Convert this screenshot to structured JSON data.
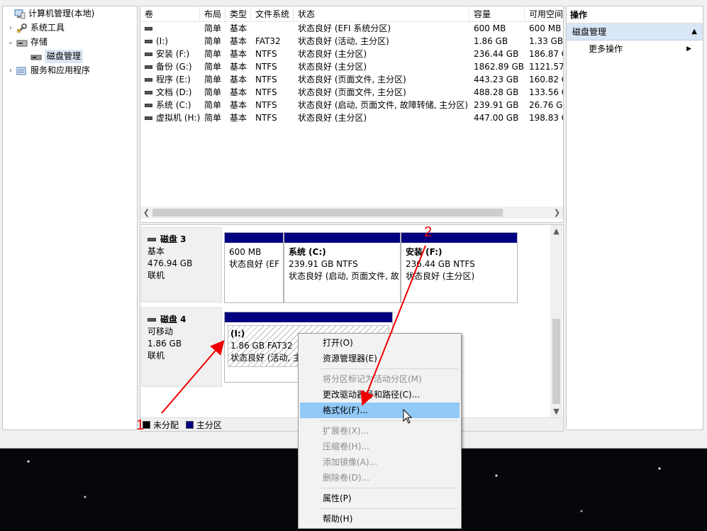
{
  "tree": {
    "items": [
      {
        "label": "计算机管理(本地)",
        "twisty": "",
        "icon": "computer-management-icon"
      },
      {
        "label": "系统工具",
        "twisty": "›",
        "icon": "system-tools-icon"
      },
      {
        "label": "存储",
        "twisty": "⌄",
        "icon": "storage-icon"
      },
      {
        "label": "磁盘管理",
        "twisty": "",
        "icon": "disk-management-icon"
      },
      {
        "label": "服务和应用程序",
        "twisty": "›",
        "icon": "services-apps-icon"
      }
    ]
  },
  "volume_list": {
    "columns": [
      "卷",
      "布局",
      "类型",
      "文件系统",
      "状态",
      "容量",
      "可用空间"
    ],
    "rows": [
      [
        "",
        "简单",
        "基本",
        "",
        "状态良好 (EFI 系统分区)",
        "600 MB",
        "600 MB"
      ],
      [
        "(I:)",
        "简单",
        "基本",
        "FAT32",
        "状态良好 (活动, 主分区)",
        "1.86 GB",
        "1.33 GB"
      ],
      [
        "安装 (F:)",
        "简单",
        "基本",
        "NTFS",
        "状态良好 (主分区)",
        "236.44 GB",
        "186.87 G"
      ],
      [
        "备份 (G:)",
        "简单",
        "基本",
        "NTFS",
        "状态良好 (主分区)",
        "1862.89 GB",
        "1121.57"
      ],
      [
        "程序 (E:)",
        "简单",
        "基本",
        "NTFS",
        "状态良好 (页面文件, 主分区)",
        "443.23 GB",
        "160.82 G"
      ],
      [
        "文档 (D:)",
        "简单",
        "基本",
        "NTFS",
        "状态良好 (页面文件, 主分区)",
        "488.28 GB",
        "133.56 G"
      ],
      [
        "系统 (C:)",
        "简单",
        "基本",
        "NTFS",
        "状态良好 (启动, 页面文件, 故障转储, 主分区)",
        "239.91 GB",
        "26.76 G"
      ],
      [
        "虚拟机 (H:)",
        "简单",
        "基本",
        "NTFS",
        "状态良好 (主分区)",
        "447.00 GB",
        "198.83 G"
      ]
    ]
  },
  "disks": [
    {
      "name": "磁盘 3",
      "type": "基本",
      "size": "476.94 GB",
      "status": "联机",
      "partitions": [
        {
          "name": "",
          "size": "600 MB",
          "status": "状态良好 (EF"
        },
        {
          "name": "系统  (C:)",
          "size": "239.91 GB NTFS",
          "status": "状态良好 (启动, 页面文件, 故"
        },
        {
          "name": "安装  (F:)",
          "size": "236.44 GB NTFS",
          "status": "状态良好 (主分区)"
        }
      ]
    },
    {
      "name": "磁盘 4",
      "type": "可移动",
      "size": "1.86 GB",
      "status": "联机",
      "partitions": [
        {
          "name": "(I:)",
          "size": "1.86 GB FAT32",
          "status": "状态良好 (活动, 主"
        }
      ]
    }
  ],
  "legend": {
    "unallocated": "未分配",
    "primary": "主分区"
  },
  "actions": {
    "title": "操作",
    "section": "磁盘管理",
    "more": "更多操作"
  },
  "context_menu": {
    "items": [
      {
        "label": "打开(O)",
        "disabled": false
      },
      {
        "label": "资源管理器(E)",
        "disabled": false
      },
      {
        "label": "将分区标记为活动分区(M)",
        "disabled": true
      },
      {
        "label": "更改驱动器号和路径(C)...",
        "disabled": false
      },
      {
        "label": "格式化(F)...",
        "disabled": false,
        "highlighted": true
      },
      {
        "label": "扩展卷(X)...",
        "disabled": true
      },
      {
        "label": "压缩卷(H)...",
        "disabled": true
      },
      {
        "label": "添加镜像(A)...",
        "disabled": true
      },
      {
        "label": "删除卷(D)...",
        "disabled": true
      },
      {
        "label": "属性(P)",
        "disabled": false
      },
      {
        "label": "帮助(H)",
        "disabled": false
      }
    ]
  },
  "annotations": {
    "step1": "1",
    "step2": "2"
  },
  "colors": {
    "primary_partition": "#000080",
    "annotation": "#ee0000",
    "menu_highlight": "#91c9f7"
  }
}
